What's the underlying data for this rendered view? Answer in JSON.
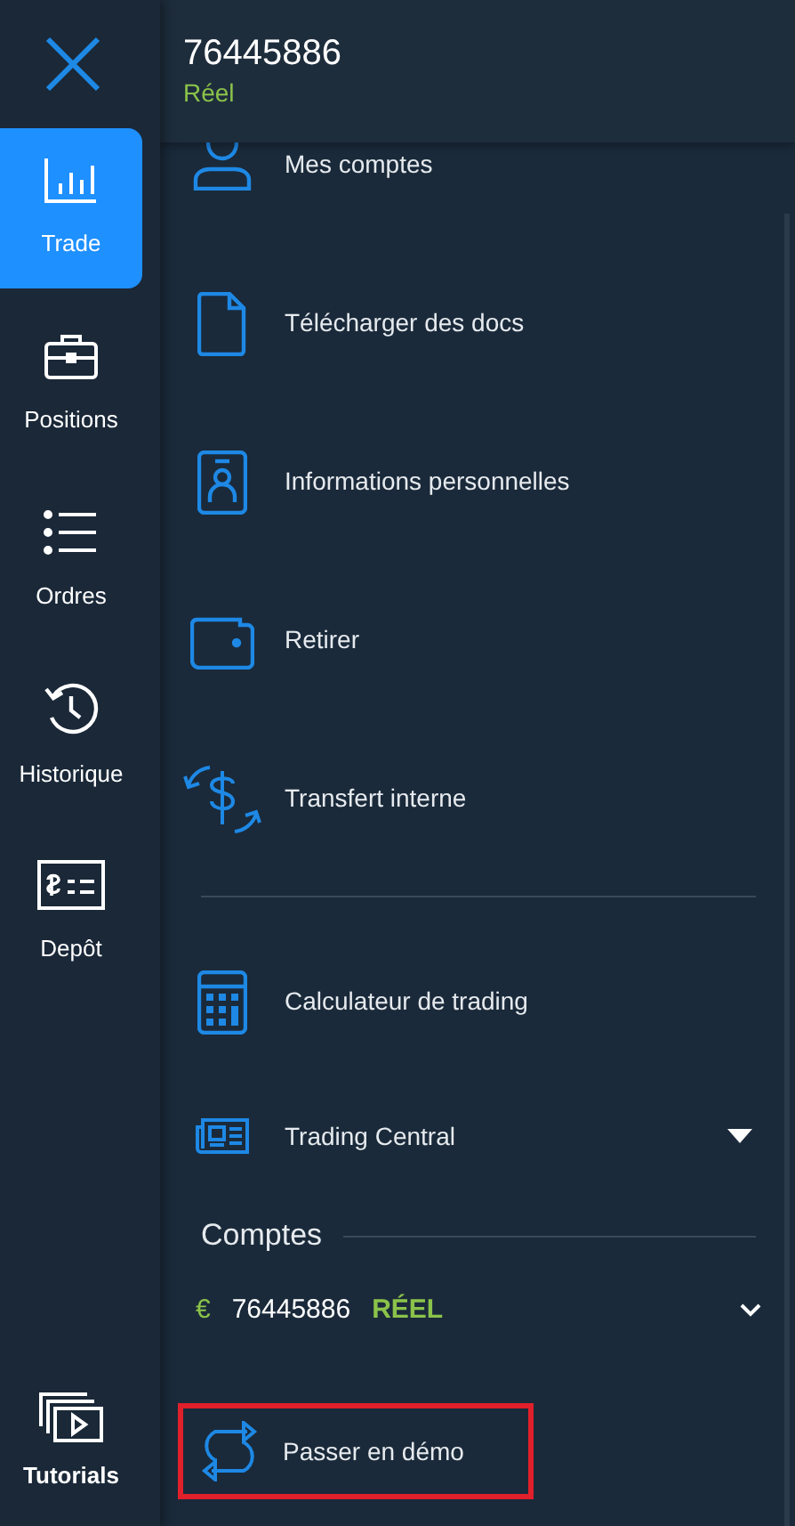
{
  "sidebar": {
    "items": [
      {
        "label": "Trade",
        "selected": true
      },
      {
        "label": "Positions",
        "selected": false
      },
      {
        "label": "Ordres",
        "selected": false
      },
      {
        "label": "Historique",
        "selected": false
      },
      {
        "label": "Depôt",
        "selected": false
      }
    ],
    "bottom_item": {
      "label": "Tutorials"
    }
  },
  "header": {
    "account_number": "76445886",
    "account_type": "Réel"
  },
  "menu": {
    "items": [
      {
        "label": "Mes comptes"
      },
      {
        "label": "Télécharger des docs"
      },
      {
        "label": "Informations personnelles"
      },
      {
        "label": "Retirer"
      },
      {
        "label": "Transfert interne"
      }
    ],
    "tools": [
      {
        "label": "Calculateur de trading",
        "kind": "link"
      },
      {
        "label": "Trading Central",
        "kind": "dropdown",
        "expanded": false
      }
    ]
  },
  "accounts": {
    "title": "Comptes",
    "current": {
      "currency": "€",
      "number": "76445886",
      "type": "RÉEL",
      "expanded": false
    },
    "switch_action": {
      "label": "Passer en démo",
      "highlighted": true
    }
  }
}
